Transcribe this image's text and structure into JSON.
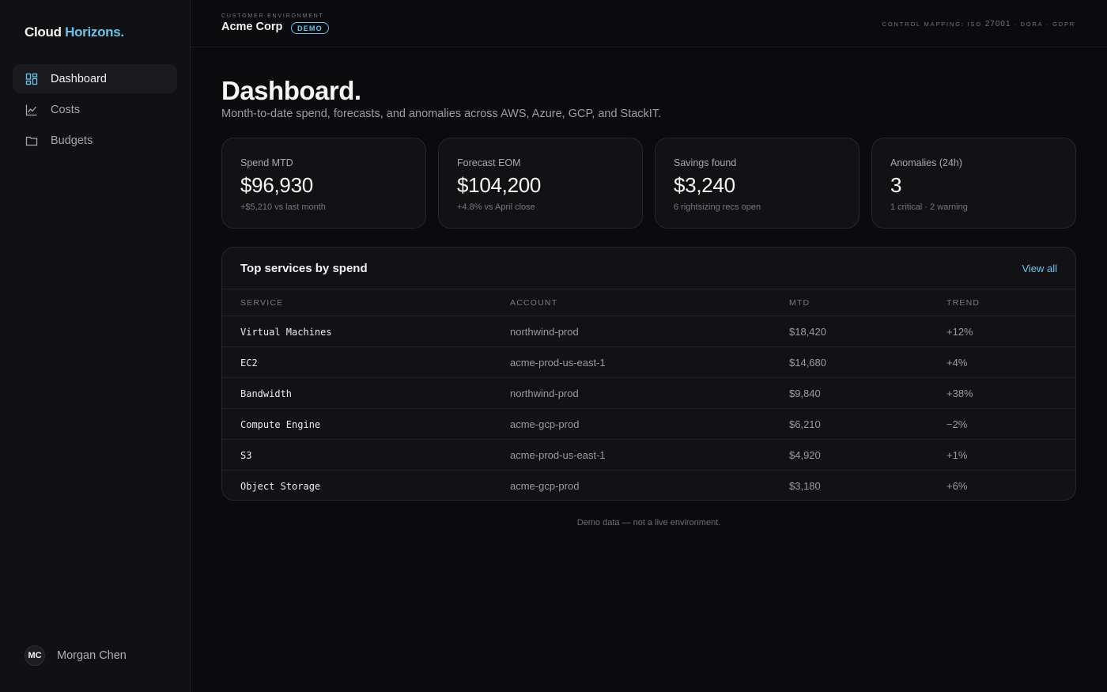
{
  "brand": {
    "name": "Cloud",
    "accent": "Horizons."
  },
  "sidebar": {
    "items": [
      {
        "label": "Dashboard",
        "icon": "grid-icon",
        "active": true
      },
      {
        "label": "Costs",
        "icon": "chart-line-icon",
        "active": false
      },
      {
        "label": "Budgets",
        "icon": "folder-icon",
        "active": false
      }
    ]
  },
  "user": {
    "initials": "MC",
    "name": "Morgan Chen"
  },
  "topbar": {
    "env_label": "Customer environment",
    "env_name": "Acme Corp",
    "badge": "DEMO",
    "control_prefix": "Control mapping: ISO",
    "control_iso": "27001",
    "control_suffix": "· DORA · GDPR"
  },
  "page": {
    "title": "Dashboard.",
    "subtitle": "Month-to-date spend, forecasts, and anomalies across AWS, Azure, GCP, and StackIT."
  },
  "kpis": [
    {
      "label": "Spend MTD",
      "value": "$96,930",
      "sub": "+$5,210 vs last month"
    },
    {
      "label": "Forecast EOM",
      "value": "$104,200",
      "sub": "+4.8% vs April close"
    },
    {
      "label": "Savings found",
      "value": "$3,240",
      "sub": "6 rightsizing recs open"
    },
    {
      "label": "Anomalies (24h)",
      "value": "3",
      "sub": "1 critical · 2 warning"
    }
  ],
  "table": {
    "title": "Top services by spend",
    "view_all": "View all",
    "columns": [
      "Service",
      "Account",
      "MTD",
      "Trend"
    ],
    "rows": [
      {
        "service": "Virtual Machines",
        "account": "northwind-prod",
        "mtd": "$18,420",
        "trend": "+12%"
      },
      {
        "service": "EC2",
        "account": "acme-prod-us-east-1",
        "mtd": "$14,680",
        "trend": "+4%"
      },
      {
        "service": "Bandwidth",
        "account": "northwind-prod",
        "mtd": "$9,840",
        "trend": "+38%"
      },
      {
        "service": "Compute Engine",
        "account": "acme-gcp-prod",
        "mtd": "$6,210",
        "trend": "−2%"
      },
      {
        "service": "S3",
        "account": "acme-prod-us-east-1",
        "mtd": "$4,920",
        "trend": "+1%"
      },
      {
        "service": "Object Storage",
        "account": "acme-gcp-prod",
        "mtd": "$3,180",
        "trend": "+6%"
      }
    ]
  },
  "footnote": "Demo data — not a live environment.",
  "colors": {
    "accent": "#6cc2ea",
    "background": "#0b0b0d",
    "sidebar": "#111113",
    "card": "#121215"
  }
}
